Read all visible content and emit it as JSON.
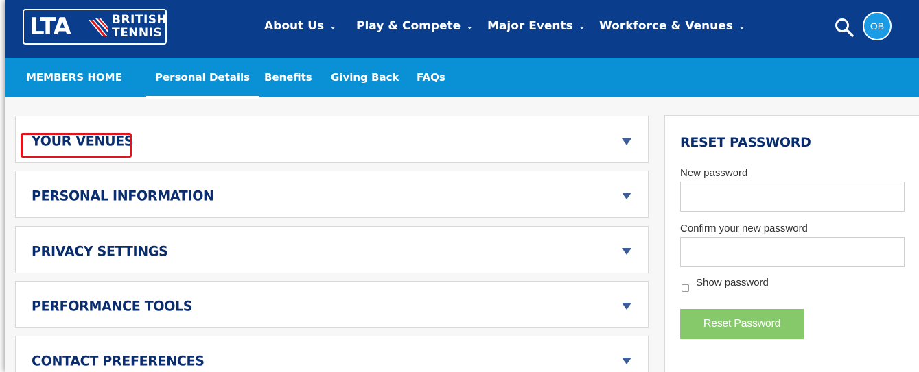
{
  "header": {
    "logo_main": "LTA",
    "logo_line1": "BRITISH",
    "logo_line2": "TENNIS",
    "nav": [
      "About Us",
      "Play & Compete",
      "Major Events",
      "Workforce & Venues"
    ],
    "avatar_initials": "OB"
  },
  "subnav": {
    "items": [
      "MEMBERS HOME",
      "Personal Details",
      "Benefits",
      "Giving Back",
      "FAQs"
    ],
    "active": "Personal Details"
  },
  "sections": [
    "YOUR VENUES",
    "PERSONAL INFORMATION",
    "PRIVACY SETTINGS",
    "PERFORMANCE TOOLS",
    "CONTACT PREFERENCES"
  ],
  "reset": {
    "title": "RESET PASSWORD",
    "new_label": "New password",
    "new_value": "",
    "confirm_label": "Confirm your new password",
    "confirm_value": "",
    "show_label": "Show password",
    "button_label": "Reset Password"
  },
  "colors": {
    "top_nav": "#0a3e8c",
    "sub_nav": "#0a90d5",
    "heading": "#0a2d6e",
    "button": "#86c96a",
    "highlight": "#e3131b"
  }
}
